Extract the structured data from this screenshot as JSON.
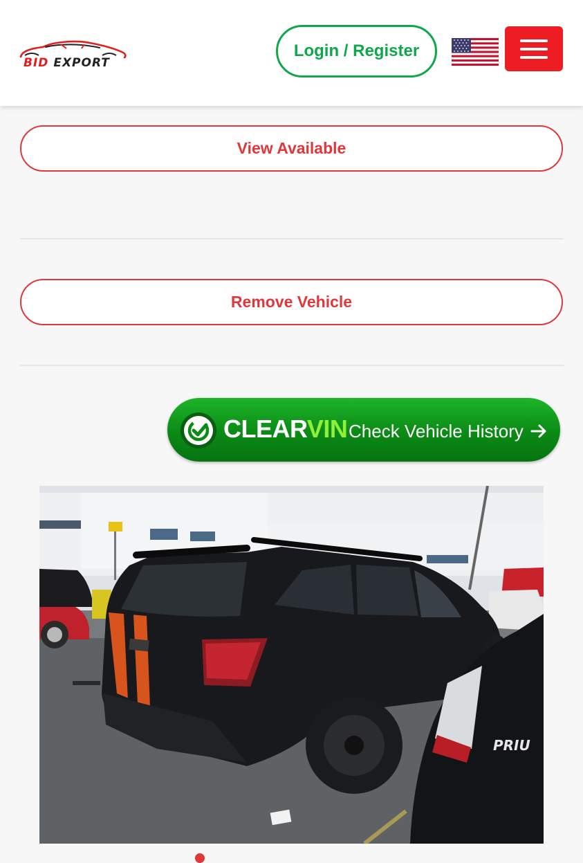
{
  "header": {
    "logo_word_a": "BID",
    "logo_word_b": "EXPORT",
    "login_label": "Login / Register",
    "flag_icon": "us-flag-icon",
    "menu_icon": "hamburger-menu-icon"
  },
  "actions": {
    "view_available_label": "View Available",
    "remove_vehicle_label": "Remove Vehicle"
  },
  "clearvin": {
    "brand_clear": "CLEAR",
    "brand_vin": "VIN",
    "tagline": "Check Vehicle History",
    "icon": "check-circle-icon",
    "arrow_icon": "arrow-right-icon"
  },
  "vehicle_photo": {
    "plate_text": "",
    "side_badge_text": "PRIU"
  },
  "colors": {
    "brand_red": "#e0373b",
    "login_green": "#0ea84a",
    "clearvin_green": "#0b8a15",
    "vin_lime": "#8ff03a",
    "menu_red": "#ee1d23"
  }
}
